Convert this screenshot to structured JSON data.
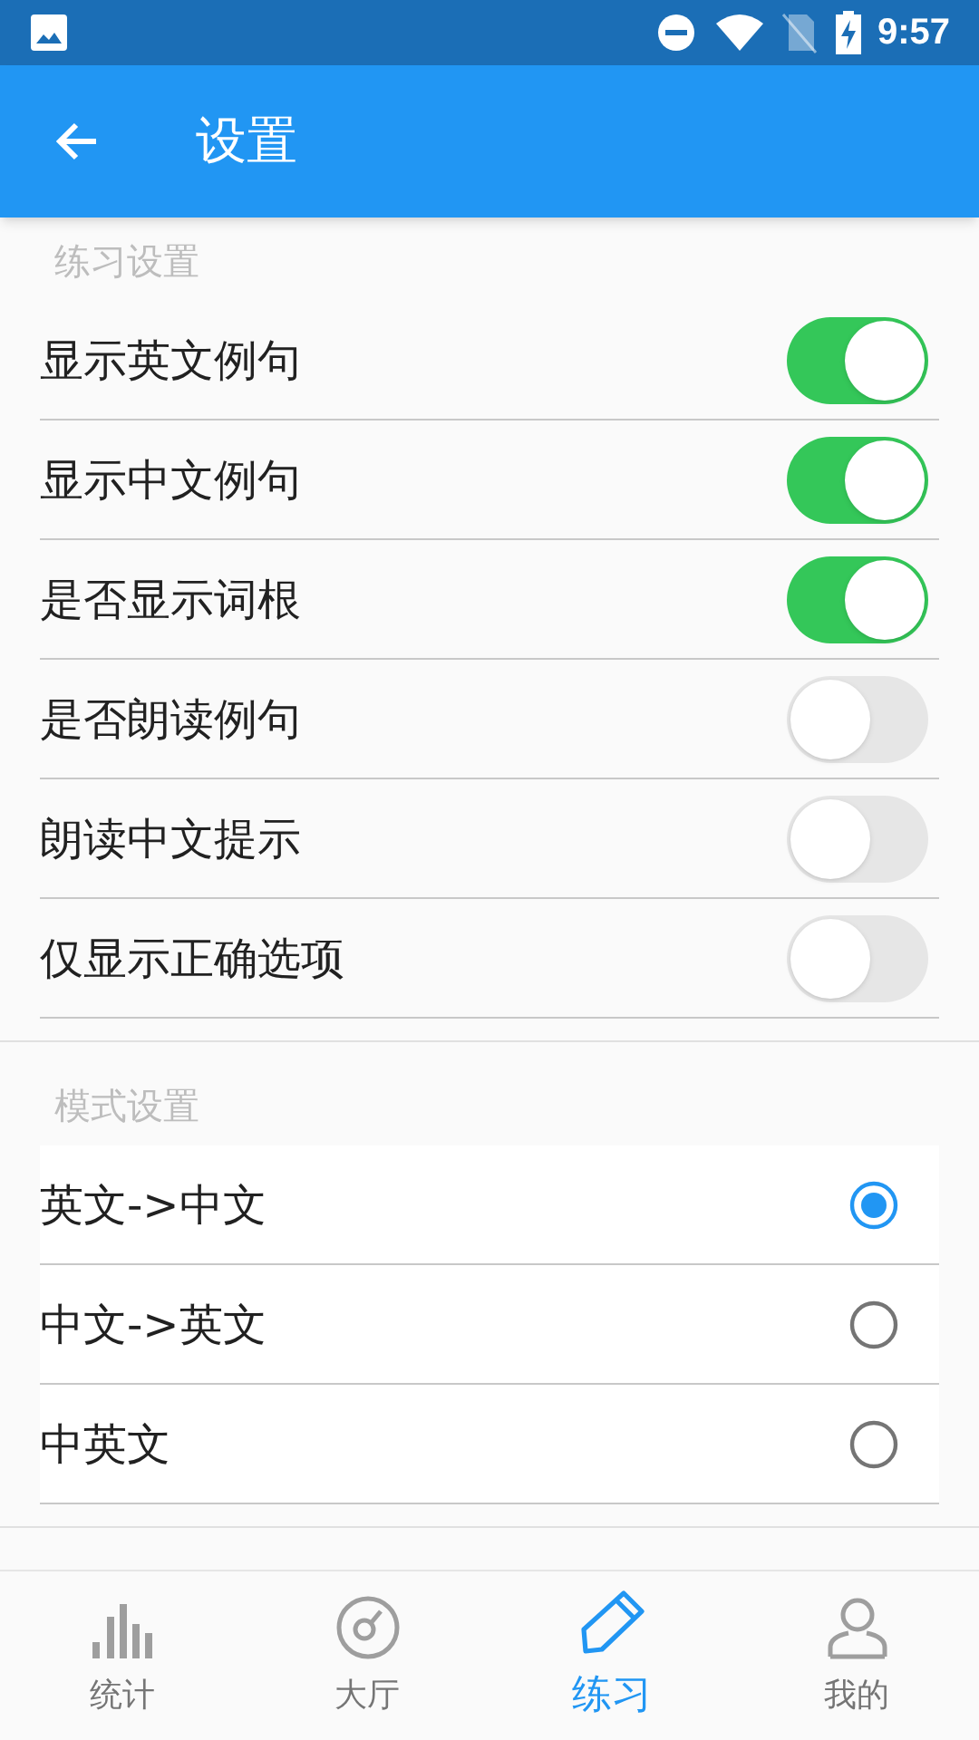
{
  "status_bar": {
    "time": "9:57"
  },
  "app_bar": {
    "title": "设置"
  },
  "practice_settings": {
    "header": "练习设置",
    "items": [
      {
        "label": "显示英文例句",
        "on": true
      },
      {
        "label": "显示中文例句",
        "on": true
      },
      {
        "label": "是否显示词根",
        "on": true
      },
      {
        "label": "是否朗读例句",
        "on": false
      },
      {
        "label": "朗读中文提示",
        "on": false
      },
      {
        "label": "仅显示正确选项",
        "on": false
      }
    ]
  },
  "mode_settings": {
    "header": "模式设置",
    "items": [
      {
        "label": "英文->中文",
        "selected": true
      },
      {
        "label": "中文->英文",
        "selected": false
      },
      {
        "label": "中英文",
        "selected": false
      }
    ]
  },
  "bottom_nav": [
    {
      "label": "统计",
      "selected": false
    },
    {
      "label": "大厅",
      "selected": false
    },
    {
      "label": "练习",
      "selected": true
    },
    {
      "label": "我的",
      "selected": false
    }
  ]
}
